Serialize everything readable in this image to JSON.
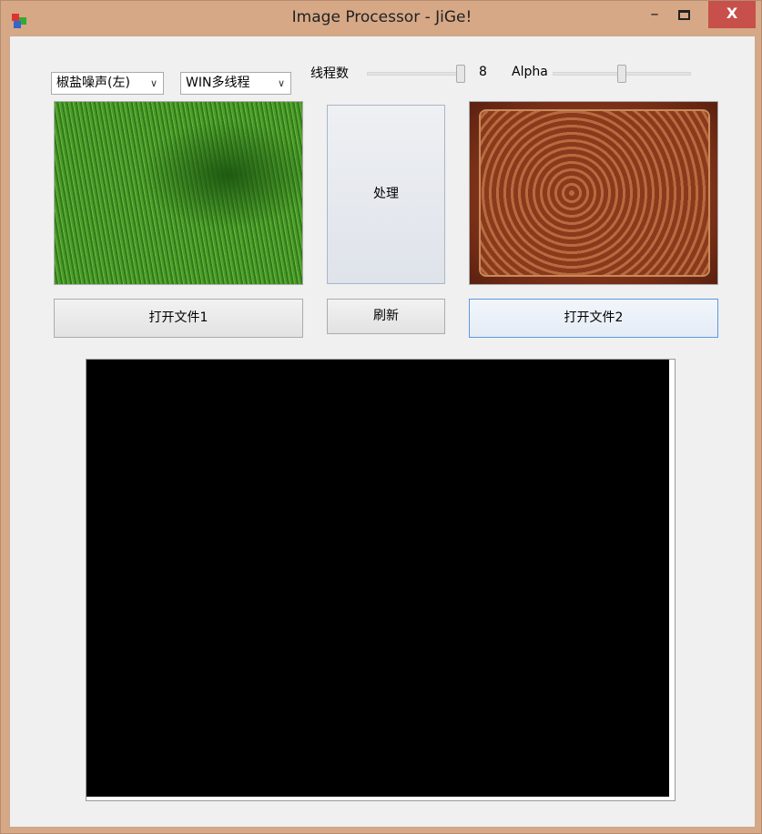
{
  "window": {
    "title": "Image Processor - JiGe!",
    "minimize": "–",
    "close": "X"
  },
  "toolbar": {
    "filter_select": "椒盐噪声(左)",
    "mode_select": "WIN多线程",
    "threads_label": "线程数",
    "threads_value": "8",
    "threads_slider_fraction": 1.0,
    "alpha_label": "Alpha",
    "alpha_slider_fraction": 0.5
  },
  "buttons": {
    "process": "处理",
    "open1": "打开文件1",
    "refresh": "刷新",
    "open2": "打开文件2"
  },
  "colors": {
    "titlebar": "#d6a886",
    "close": "#c7504a",
    "output": "#000000"
  }
}
